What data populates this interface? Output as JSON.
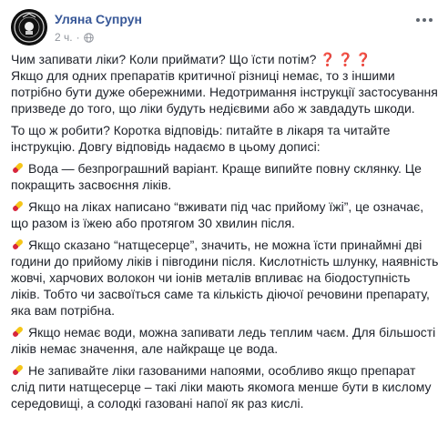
{
  "post": {
    "author": "Уляна Супрун",
    "time": "2 ч.",
    "question_line": "Чим запивати ліки? Коли приймати? Що їсти потім?",
    "question_marks": "❓❓❓",
    "intro": "Якщо для одних препаратів критичної різниці немає, то з іншими потрібно бути дуже обережними. Недотримання інструкції застосування призведе до того, що ліки будуть недієвими або ж завдадуть шкоди.",
    "answer": "То що ж робити? Коротка відповідь: питайте в лікаря та читайте інструкцію. Довгу відповідь надаємо в цьому дописі:",
    "bullets": [
      "Вода — безпрограшний варіант. Краще випийте повну склянку. Це покращить засвоєння ліків.",
      "Якщо на ліках написано “вживати під час прийому їжі”, це означає, що разом із їжею або протягом 30 хвилин після.",
      "Якщо сказано “натщесерце”, значить, не можна їсти принаймні дві години до прийому ліків і півгодини після. Кислотність шлунку, наявність жовчі, харчових волокон чи іонів металів впливає на біодоступність ліків. Тобто чи засвоїться саме та кількість діючої речовини препарату, яка вам потрібна.",
      "Якщо немає води, можна запивати ледь теплим чаєм. Для більшості ліків немає значення, але найкраще це вода.",
      "Не запивайте ліки газованими напоями, особливо якщо препарат слід пити натщесерце – такі ліки мають якомога менше бути в кислому середовищі, а солодкі газовані напої як раз кислі."
    ]
  },
  "icons": {
    "bullet": "pill-icon",
    "privacy": "globe-icon",
    "menu": "more-options-icon"
  },
  "colors": {
    "author_link": "#385898",
    "text": "#1d2129",
    "meta": "#90949c",
    "question_mark": "#e0245e",
    "pill_red": "#d7263d",
    "pill_yellow": "#f5c518"
  }
}
